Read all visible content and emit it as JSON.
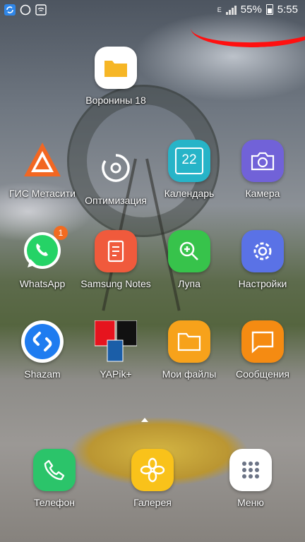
{
  "status_bar": {
    "battery_percent": "55%",
    "time": "5:55",
    "network_letter": "E"
  },
  "apps": {
    "voronin": {
      "label": "Воронины 18"
    },
    "gis": {
      "label": "ГИС Метасити"
    },
    "optimization": {
      "label": "Оптимизация"
    },
    "calendar": {
      "label": "Календарь",
      "day": "22"
    },
    "camera": {
      "label": "Камера"
    },
    "whatsapp": {
      "label": "WhatsApp",
      "badge": "1"
    },
    "samsung_notes": {
      "label": "Samsung Notes"
    },
    "magnifier": {
      "label": "Лупа"
    },
    "settings": {
      "label": "Настройки"
    },
    "shazam": {
      "label": "Shazam"
    },
    "yapik": {
      "label": "YAPik+"
    },
    "my_files": {
      "label": "Мои файлы"
    },
    "messages": {
      "label": "Сообщения"
    }
  },
  "dock": {
    "phone": {
      "label": "Телефон"
    },
    "gallery": {
      "label": "Галерея"
    },
    "menu": {
      "label": "Меню"
    }
  },
  "colors": {
    "folder_yellow": "#f6b626",
    "calendar_teal": "#27b4c8",
    "camera_purple": "#7162d8",
    "whatsapp_green": "#25d366",
    "notes_orange": "#f05a3c",
    "magnifier_green": "#37c34b",
    "settings_blue": "#5a72e6",
    "shazam_blue": "#1e7cf0",
    "files_orange": "#f7a21b",
    "messages_orange": "#f58b12",
    "phone_green": "#2bc46a",
    "gallery_yellow": "#f9c21a",
    "menu_white": "#ffffff",
    "annotation_red": "#ff1010"
  }
}
